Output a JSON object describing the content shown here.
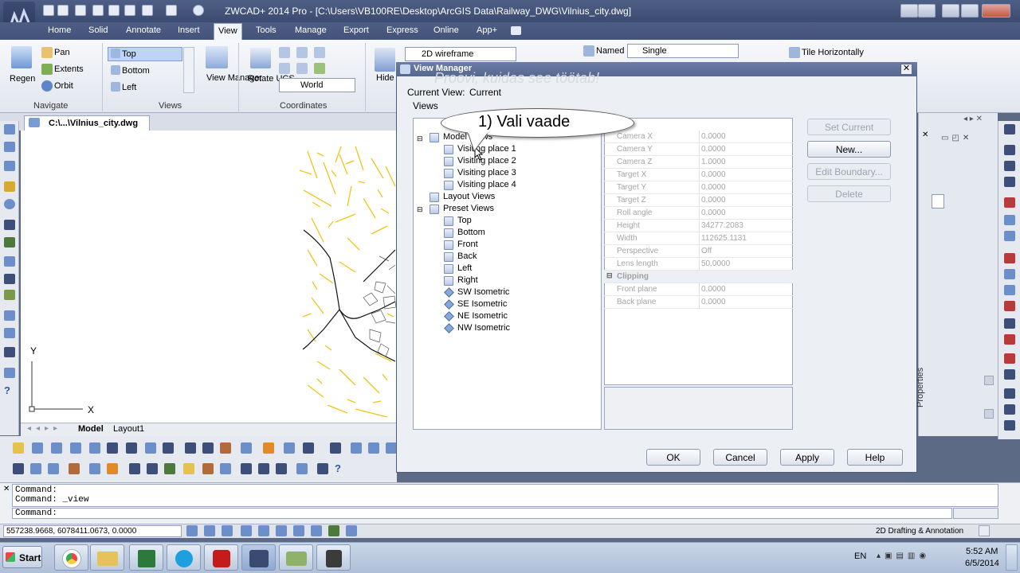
{
  "app": {
    "title": "ZWCAD+ 2014 Pro - [C:\\Users\\VB100RE\\Desktop\\ArcGIS Data\\Railway_DWG\\Vilnius_city.dwg]"
  },
  "ribbon_tabs": [
    "Home",
    "Solid",
    "Annotate",
    "Insert",
    "View",
    "Tools",
    "Manage",
    "Export",
    "Express",
    "Online",
    "App+"
  ],
  "active_tab": "View",
  "ribbon": {
    "navigate": {
      "label": "Navigate",
      "regen": "Regen",
      "pan": "Pan",
      "extents": "Extents",
      "orbit": "Orbit"
    },
    "views": {
      "label": "Views",
      "items": [
        "Top",
        "Bottom",
        "Left"
      ],
      "view_manager": "View Manager"
    },
    "coordinates": {
      "label": "Coordinates",
      "rotate_ucs": "Rotate UCS",
      "world": "World"
    },
    "visual": {
      "hide": "Hide",
      "style": "2D wireframe"
    },
    "viewports": {
      "named": "Named",
      "single": "Single"
    },
    "windows": {
      "tile": "Tile Horizontally"
    }
  },
  "doc_tab": "C:\\...\\Vilnius_city.dwg",
  "layout_tabs": [
    "Model",
    "Layout1"
  ],
  "dialog": {
    "title": "View Manager",
    "current_view_label": "Current View:",
    "current_view_value": "Current",
    "views_label": "Views",
    "hint_overlay": "Proovi, kuidas see töötab!",
    "callout": "1) Vali vaade",
    "tree": {
      "model_views": "Model Views",
      "model_items": [
        "Visiting place 1",
        "Visiting place 2",
        "Visiting place 3",
        "Visiting place 4"
      ],
      "layout_views": "Layout Views",
      "preset_views": "Preset Views",
      "preset_items": [
        "Top",
        "Bottom",
        "Front",
        "Back",
        "Left",
        "Right"
      ],
      "iso_items": [
        "SW Isometric",
        "SE Isometric",
        "NE Isometric",
        "NW Isometric"
      ]
    },
    "properties": [
      {
        "k": "Camera X",
        "v": "0.0000"
      },
      {
        "k": "Camera Y",
        "v": "0.0000"
      },
      {
        "k": "Camera Z",
        "v": "1.0000"
      },
      {
        "k": "Target X",
        "v": "0.0000"
      },
      {
        "k": "Target Y",
        "v": "0.0000"
      },
      {
        "k": "Target Z",
        "v": "0.0000"
      },
      {
        "k": "Roll angle",
        "v": "0.0000"
      },
      {
        "k": "Height",
        "v": "34277.2083"
      },
      {
        "k": "Width",
        "v": "112625.1131"
      },
      {
        "k": "Perspective",
        "v": "Off"
      },
      {
        "k": "Lens length",
        "v": "50.0000"
      }
    ],
    "clipping_label": "Clipping",
    "clipping": [
      {
        "k": "Front plane",
        "v": "0.0000"
      },
      {
        "k": "Back plane",
        "v": "0.0000"
      }
    ],
    "side_buttons": [
      "Set Current",
      "New...",
      "Edit Boundary...",
      "Delete"
    ],
    "bottom_buttons": [
      "OK",
      "Cancel",
      "Apply",
      "Help"
    ]
  },
  "properties_panel_label": "Properties",
  "command": {
    "history": [
      "Command:",
      "Command: _view"
    ],
    "prompt": "Command:"
  },
  "status": {
    "coords": "557238.9668, 6078411.0673, 0.0000",
    "workspace": "2D Drafting & Annotation"
  },
  "taskbar": {
    "start": "Start",
    "lang": "EN",
    "time": "5:52 AM",
    "date": "6/5/2014"
  },
  "axis": {
    "x": "X",
    "y": "Y"
  },
  "colors": {
    "accent": "#3b4a70",
    "drawing_yellow": "#f0c419",
    "tab_active": "#f3f5f9"
  }
}
